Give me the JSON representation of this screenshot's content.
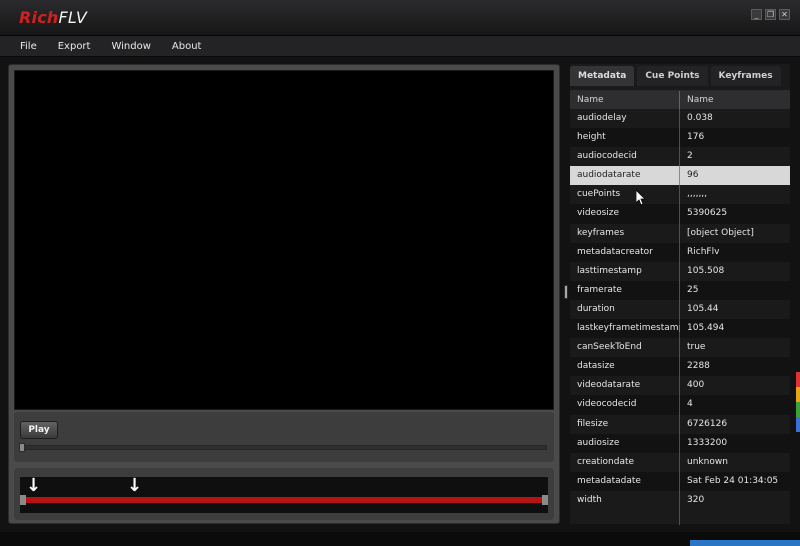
{
  "window": {
    "logo_left": "Rich",
    "logo_right": "FLV",
    "controls": {
      "minimize": "_",
      "maximize": "❐",
      "close": "✕"
    }
  },
  "menu": {
    "items": [
      "File",
      "Export",
      "Window",
      "About"
    ]
  },
  "player": {
    "play_label": "Play"
  },
  "metadata_panel": {
    "tabs": [
      "Metadata",
      "Cue Points",
      "Keyframes"
    ],
    "active_tab": "Metadata",
    "columns": [
      "Name",
      "Name"
    ],
    "rows": [
      {
        "name": "audiodelay",
        "value": "0.038"
      },
      {
        "name": "height",
        "value": "176"
      },
      {
        "name": "audiocodecid",
        "value": "2"
      },
      {
        "name": "audiodatarate",
        "value": "96"
      },
      {
        "name": "cuePoints",
        "value": ",,,,,,,"
      },
      {
        "name": "videosize",
        "value": "5390625"
      },
      {
        "name": "keyframes",
        "value": "[object Object]"
      },
      {
        "name": "metadatacreator",
        "value": "RichFlv"
      },
      {
        "name": "lasttimestamp",
        "value": "105.508"
      },
      {
        "name": "framerate",
        "value": "25"
      },
      {
        "name": "duration",
        "value": "105.44"
      },
      {
        "name": "lastkeyframetimestamp",
        "value": "105.494"
      },
      {
        "name": "canSeekToEnd",
        "value": "true"
      },
      {
        "name": "datasize",
        "value": "2288"
      },
      {
        "name": "videodatarate",
        "value": "400"
      },
      {
        "name": "videocodecid",
        "value": "4"
      },
      {
        "name": "filesize",
        "value": "6726126"
      },
      {
        "name": "audiosize",
        "value": "1333200"
      },
      {
        "name": "creationdate",
        "value": "unknown"
      },
      {
        "name": "metadatadate",
        "value": "Sat Feb 24 01:34:05"
      },
      {
        "name": "width",
        "value": "320"
      }
    ],
    "selected_row": 3
  },
  "colors": {
    "accent_red": "#d21f1f",
    "cue_bar": "#b61414",
    "selection": "#d8d8d8"
  }
}
